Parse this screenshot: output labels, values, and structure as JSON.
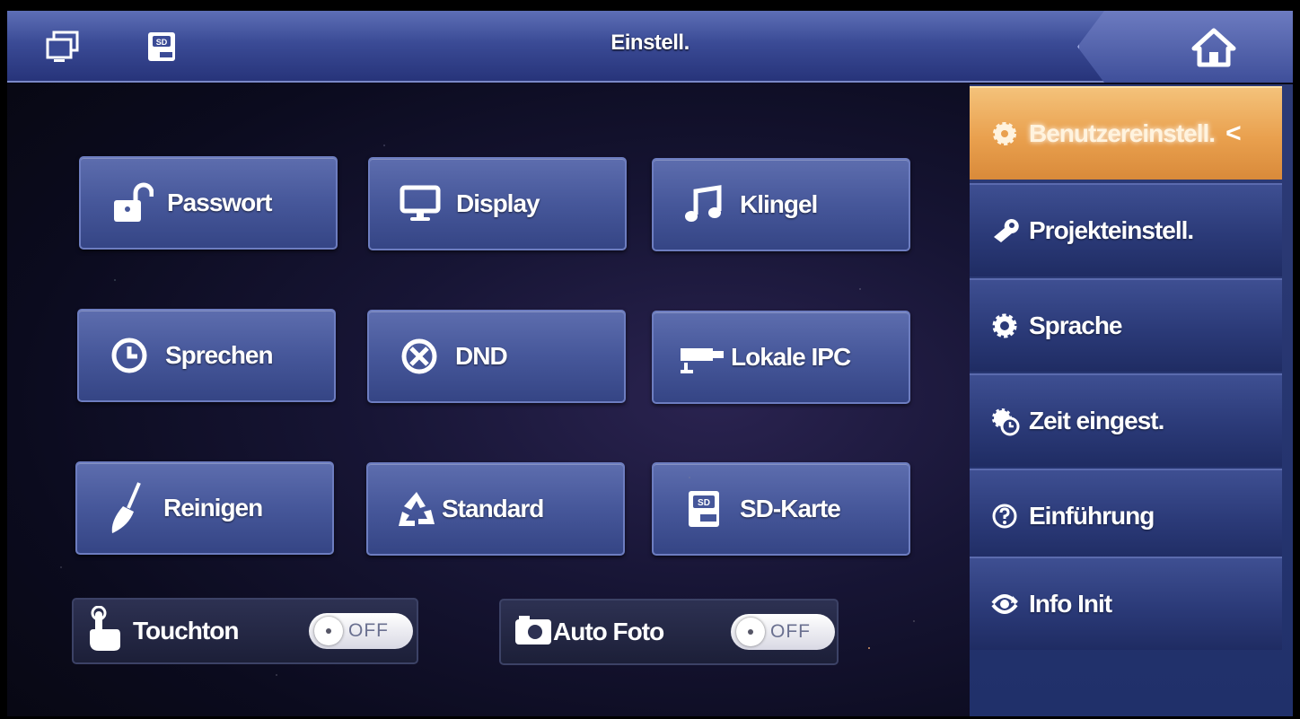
{
  "header": {
    "title": "Einstell."
  },
  "icons": {
    "monitor": "monitor-icon",
    "sd": "sd-card-icon",
    "home": "home-icon"
  },
  "grid": [
    {
      "label": "Passwort",
      "icon": "unlock-icon"
    },
    {
      "label": "Display",
      "icon": "monitor-icon"
    },
    {
      "label": "Klingel",
      "icon": "music-note-icon"
    },
    {
      "label": "Sprechen",
      "icon": "clock-icon"
    },
    {
      "label": "DND",
      "icon": "do-not-disturb-icon"
    },
    {
      "label": "Lokale IPC",
      "icon": "camera-icon"
    },
    {
      "label": "Reinigen",
      "icon": "broom-icon"
    },
    {
      "label": "Standard",
      "icon": "recycle-icon"
    },
    {
      "label": "SD-Karte",
      "icon": "sd-card-icon"
    }
  ],
  "toggles": [
    {
      "label": "Touchton",
      "state": "OFF",
      "icon": "touch-hand-icon"
    },
    {
      "label": "Auto Foto",
      "state": "OFF",
      "icon": "photo-camera-icon"
    }
  ],
  "sidebar": {
    "items": [
      {
        "label": "Benutzereinstell.",
        "icon": "gear-icon",
        "active": true
      },
      {
        "label": "Projekteinstell.",
        "icon": "wrench-icon"
      },
      {
        "label": "Sprache",
        "icon": "gear-icon"
      },
      {
        "label": "Zeit eingest.",
        "icon": "gear-clock-icon"
      },
      {
        "label": "Einführung",
        "icon": "help-icon"
      },
      {
        "label": "Info Init",
        "icon": "reset-icon"
      }
    ],
    "active_chevron": "<"
  },
  "colors": {
    "accent_active": "#e9a04e",
    "button_blue": "#46579a",
    "topbar": "#3b4b96"
  }
}
